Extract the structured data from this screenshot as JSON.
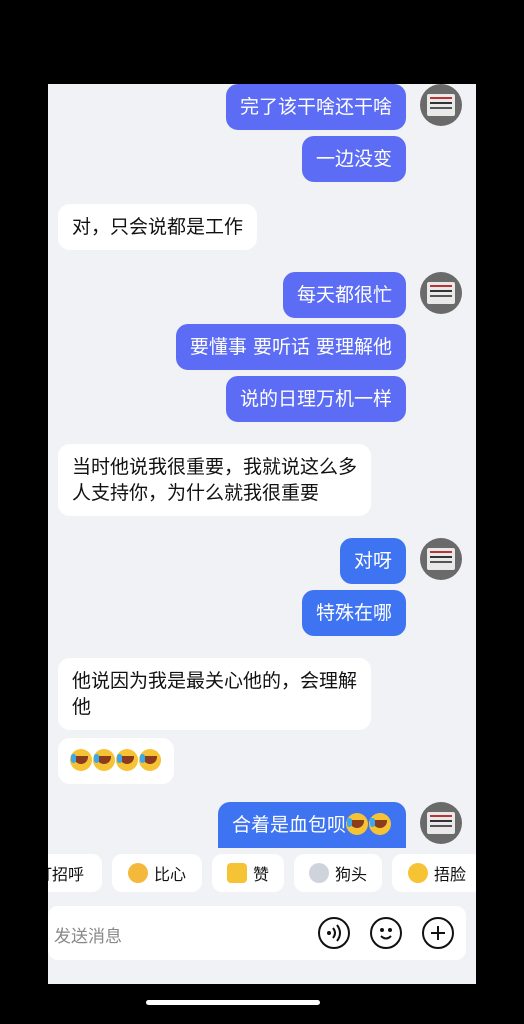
{
  "messages": [
    {
      "id": "m1",
      "dir": "out",
      "text": "完了该干啥还干啥"
    },
    {
      "id": "m2",
      "dir": "out",
      "text": "一边没变"
    },
    {
      "id": "m3",
      "dir": "in",
      "text": "对，只会说都是工作"
    },
    {
      "id": "m4",
      "dir": "out",
      "text": "每天都很忙"
    },
    {
      "id": "m5",
      "dir": "out",
      "text": "要懂事 要听话 要理解他"
    },
    {
      "id": "m6",
      "dir": "out",
      "text": "说的日理万机一样"
    },
    {
      "id": "m7",
      "dir": "in",
      "lines": [
        "当时他说我很重要，我就说这么多",
        "人支持你，为什么就我很重要"
      ]
    },
    {
      "id": "m8",
      "dir": "out",
      "text": "对呀"
    },
    {
      "id": "m9",
      "dir": "out",
      "text": "特殊在哪"
    },
    {
      "id": "m10",
      "dir": "in",
      "lines": [
        "他说因为我是最关心他的，会理解",
        "他"
      ]
    },
    {
      "id": "m11",
      "dir": "in",
      "emoji": "laugh-cry",
      "count": 4
    },
    {
      "id": "m12",
      "dir": "out",
      "text": "合着是血包呗",
      "emoji": "laugh-cry",
      "count": 2
    }
  ],
  "quick_replies": [
    {
      "label": "打招呼",
      "icon": "wave-icon"
    },
    {
      "label": "比心",
      "icon": "heart-hands-icon"
    },
    {
      "label": "赞",
      "icon": "thumbs-up-icon"
    },
    {
      "label": "狗头",
      "icon": "doge-icon"
    },
    {
      "label": "捂脸",
      "icon": "facepalm-icon"
    }
  ],
  "input": {
    "placeholder": "发送消息"
  },
  "input_icons": [
    "voice-icon",
    "emoji-icon",
    "plus-icon"
  ],
  "colors": {
    "outgoing_bubble": "#5c6cf5",
    "outgoing_bubble_alt": "#3e73f2",
    "incoming_bubble": "#ffffff",
    "chat_bg": "#f1f2f6"
  }
}
